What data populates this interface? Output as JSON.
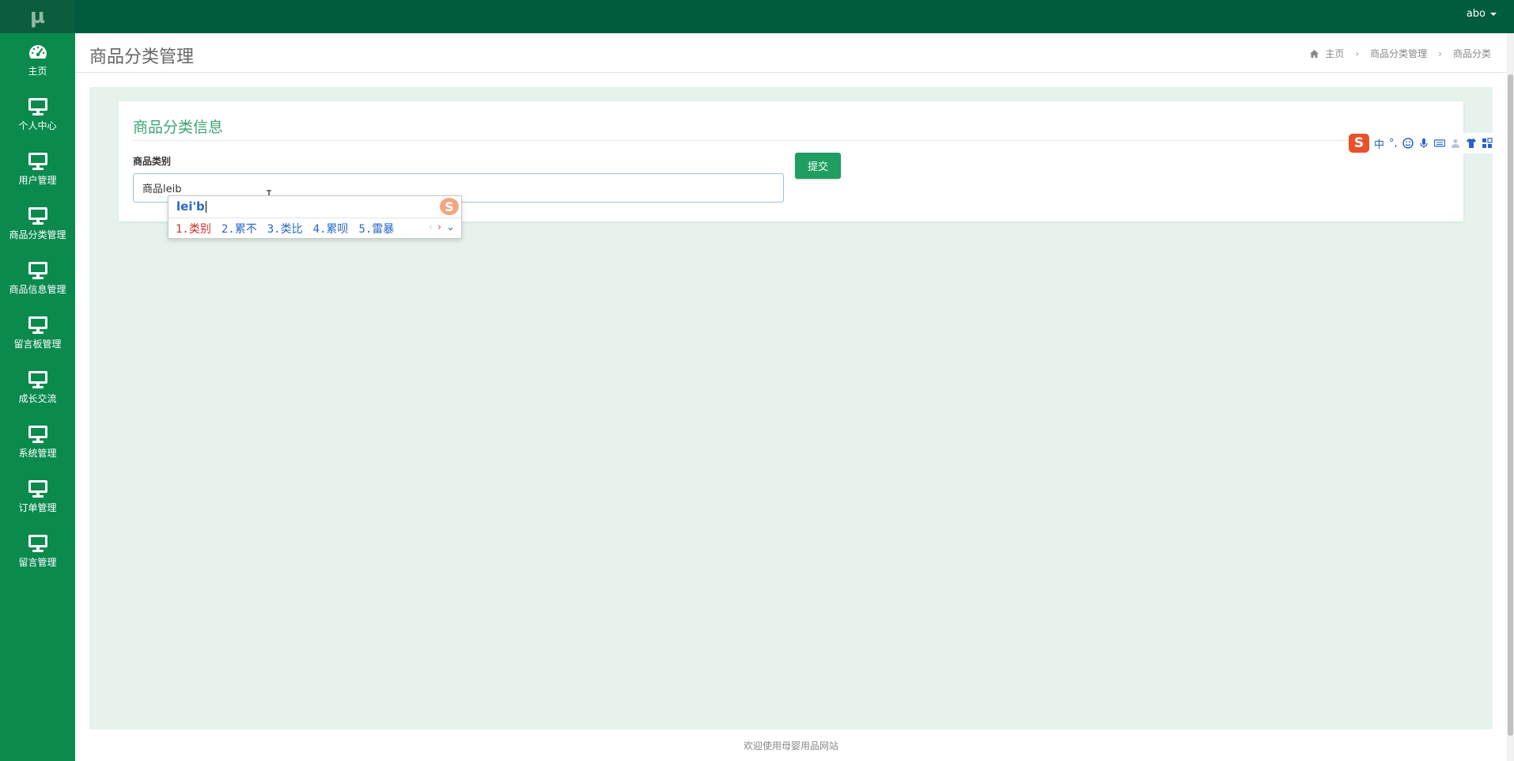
{
  "app": {
    "logo": "µ",
    "user": "abo"
  },
  "sidebar": {
    "items": [
      {
        "label": "主页",
        "icon": "dashboard-icon"
      },
      {
        "label": "个人中心",
        "icon": "monitor-icon"
      },
      {
        "label": "用户管理",
        "icon": "monitor-icon"
      },
      {
        "label": "商品分类管理",
        "icon": "monitor-icon"
      },
      {
        "label": "商品信息管理",
        "icon": "monitor-icon"
      },
      {
        "label": "留言板管理",
        "icon": "monitor-icon"
      },
      {
        "label": "成长交流",
        "icon": "monitor-icon"
      },
      {
        "label": "系统管理",
        "icon": "monitor-icon"
      },
      {
        "label": "订单管理",
        "icon": "monitor-icon"
      },
      {
        "label": "留言管理",
        "icon": "monitor-icon"
      }
    ]
  },
  "header": {
    "title": "商品分类管理",
    "breadcrumb": [
      "主页",
      "商品分类管理",
      "商品分类"
    ]
  },
  "form": {
    "card_title": "商品分类信息",
    "field_label": "商品类别",
    "field_value": "商品leib",
    "submit_label": "提交"
  },
  "ime": {
    "composition": "lei'b",
    "candidates": [
      "1.类别",
      "2.累不",
      "3.类比",
      "4.累呗",
      "5.雷暴"
    ],
    "logo": "S",
    "toolbar": {
      "badge": "S",
      "mode": "中",
      "punct": "°,"
    }
  },
  "footer": {
    "text": "欢迎使用母婴用品网站"
  },
  "colors": {
    "sidebar": "#0b8a4e",
    "topbar": "#015c3e",
    "content_bg": "#e6f2ec",
    "accent": "#3ea574",
    "submit": "#1e9e60"
  }
}
